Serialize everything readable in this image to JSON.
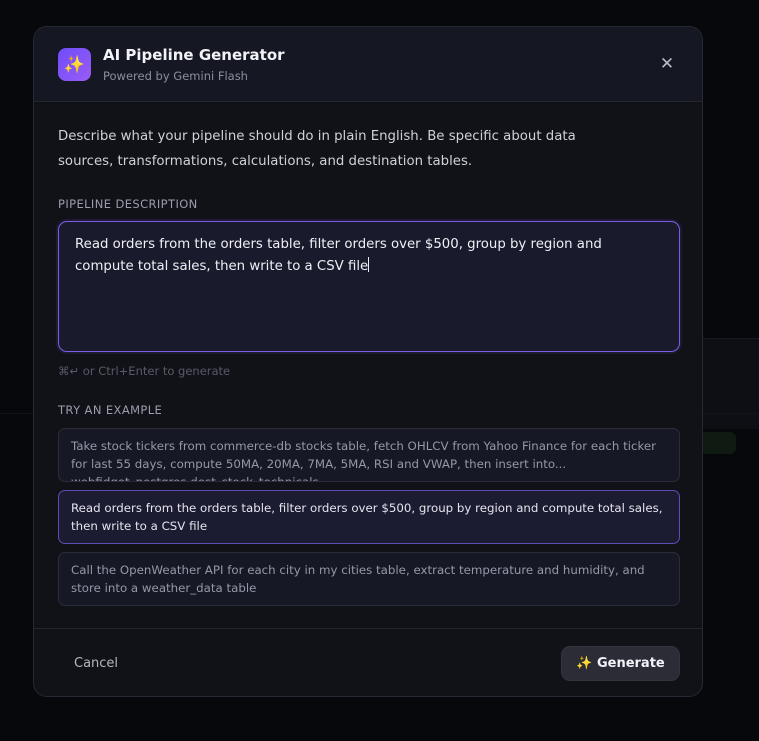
{
  "dialog": {
    "title": "AI Pipeline Generator",
    "subtitle": "Powered by Gemini Flash",
    "app_icon": "sparkles-icon",
    "close_label": "✕"
  },
  "body": {
    "intro": "Describe what your pipeline should do in plain English. Be specific about data sources, transformations, calculations, and destination tables.",
    "description_label": "PIPELINE DESCRIPTION",
    "description_value": "Read orders from the orders table, filter orders over $500, group by region and compute total sales, then write to a CSV file",
    "hint": "⌘↵ or Ctrl+Enter to generate",
    "examples_label": "TRY AN EXAMPLE",
    "examples": [
      {
        "text": "Take stock tickers from commerce-db stocks table, fetch OHLCV from Yahoo Finance for each ticker for last 55 days, compute 50MA, 20MA, 7MA, 5MA, RSI and VWAP, then insert into... webfidget_postgres dest_stock_technicals"
      },
      {
        "text": "Read orders from the orders table, filter orders over $500, group by region and compute total sales, then write to a CSV file"
      },
      {
        "text": "Call the OpenWeather API for each city in my cities table, extract temperature and humidity, and store into a weather_data table"
      }
    ]
  },
  "footer": {
    "cancel_label": "Cancel",
    "generate_label": "✨ Generate"
  },
  "colors": {
    "accent": "#7b5ce6",
    "modal_bg": "#111218",
    "button_bg": "#2b2c35"
  }
}
